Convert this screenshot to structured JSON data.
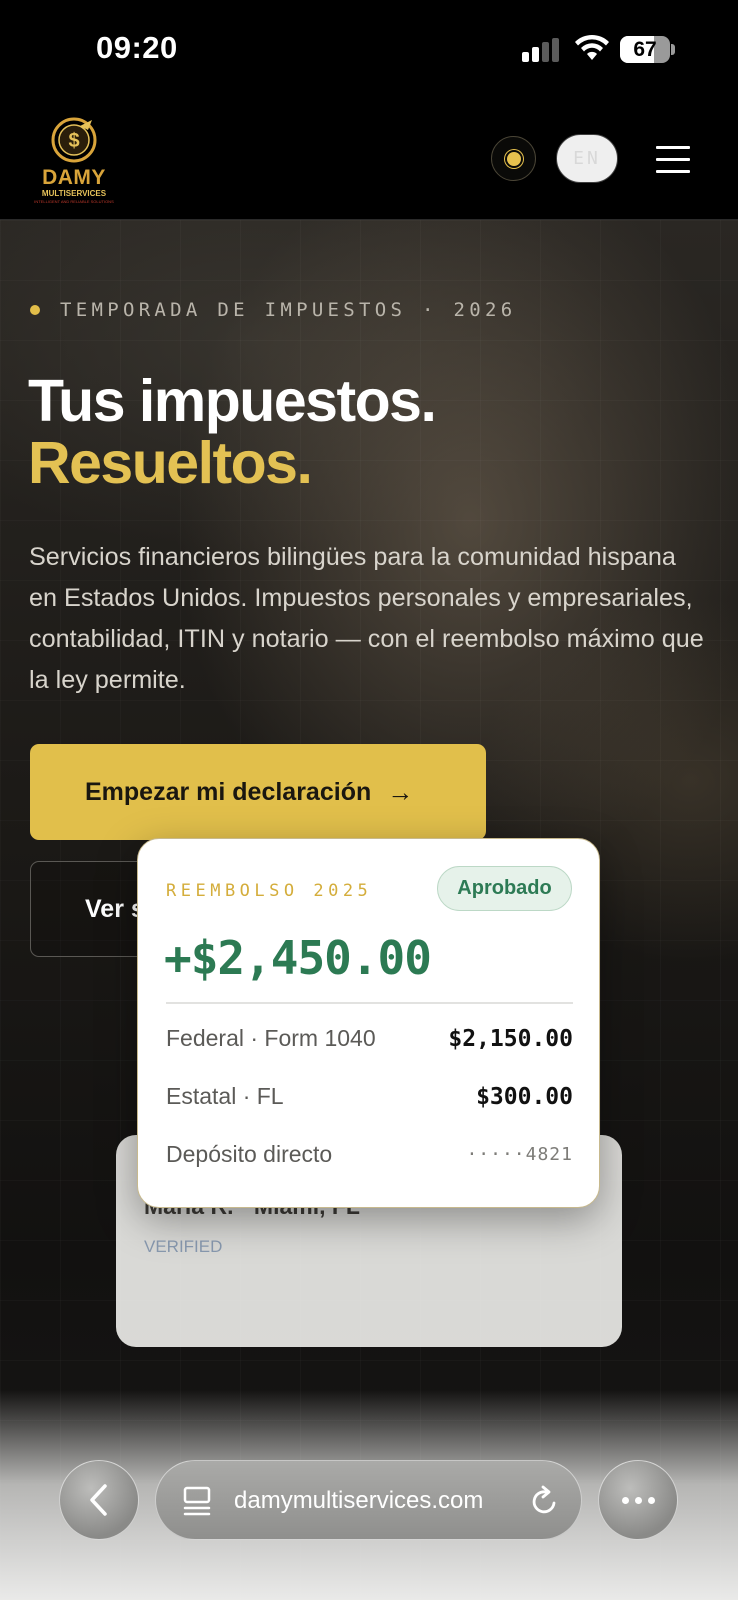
{
  "status_bar": {
    "time": "09:20",
    "battery": "67",
    "battery_level": 0.67
  },
  "header": {
    "logo": {
      "name": "DAMY",
      "sub": "MULTISERVICES",
      "tagline": "INTELLIGENT AND RELIABLE SOLUTIONS"
    },
    "theme_icon": "sun-icon",
    "lang_label": "EN",
    "menu_icon": "hamburger-icon"
  },
  "hero": {
    "eyebrow": "TEMPORADA DE IMPUESTOS · 2026",
    "title_line1": "Tus impuestos.",
    "title_line2": "Resueltos.",
    "description": "Servicios financieros bilingües para la comunidad hispana en Estados Unidos. Impuestos personales y empresariales, contabilidad, ITIN y notario — con el reembolso máximo que la ley permite.",
    "primary_cta": "Empezar mi declaración",
    "primary_cta_icon": "arrow-right-icon",
    "secondary_cta": "Ver servicios"
  },
  "refund_card": {
    "label": "REEMBOLSO 2025",
    "status": "Aprobado",
    "amount": "+$2,450.00",
    "rows": [
      {
        "label": "Federal · Form 1040",
        "value": "$2,150.00"
      },
      {
        "label": "Estatal · FL",
        "value": "$300.00"
      },
      {
        "label": "Depósito directo",
        "value": "·····4821"
      }
    ]
  },
  "testimonial_card": {
    "name": "María R. · Miami, FL",
    "badge": "VERIFIED"
  },
  "browser_bar": {
    "url": "damymultiservices.com",
    "back_icon": "chevron-left-icon",
    "tabs_icon": "tabs-icon",
    "reload_icon": "reload-icon",
    "more_icon": "more-icon"
  },
  "colors": {
    "accent_gold": "#e1bf4b",
    "success_green": "#2c7a53",
    "background": "#0d0c0b"
  }
}
